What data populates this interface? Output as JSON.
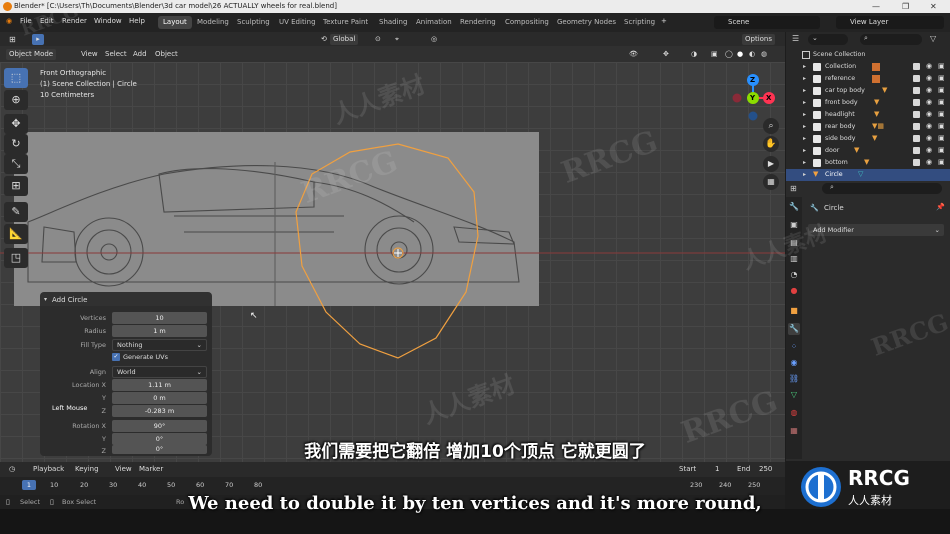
{
  "titlebar": {
    "title": "Blender* [C:\\Users\\Th\\Documents\\Blender\\3d car model\\26 ACTUALLY wheels for real.blend]",
    "minimize": "—",
    "maximize": "❐",
    "close": "✕"
  },
  "menu": {
    "items": [
      "Edit",
      "Render",
      "Window",
      "Help"
    ],
    "file_label": "File",
    "workspaces": [
      "Layout",
      "Modeling",
      "Sculpting",
      "UV Editing",
      "Texture Paint",
      "Shading",
      "Animation",
      "Rendering",
      "Compositing",
      "Geometry Nodes",
      "Scripting"
    ],
    "active_workspace": "Layout",
    "add_workspace": "+",
    "scene": "Scene",
    "view_layer": "View Layer"
  },
  "viewport_header": {
    "mode": "Object Mode",
    "menus": [
      "View",
      "Select",
      "Add",
      "Object"
    ],
    "transform_orientation": "Global",
    "options": "Options"
  },
  "viewport": {
    "view_name": "Front Orthographic",
    "collection_info": "(1) Scene Collection | Circle",
    "scale": "10 Centimeters",
    "gizmo": {
      "x": "X",
      "y": "Y",
      "z": "Z"
    },
    "cursor_hint": "Left Mouse"
  },
  "tools": [
    "select-box",
    "cursor",
    "move",
    "rotate",
    "scale",
    "transform",
    "annotate",
    "measure",
    "add-cube"
  ],
  "operator_panel": {
    "title": "Add Circle",
    "vertices_label": "Vertices",
    "vertices": "10",
    "radius_label": "Radius",
    "radius": "1 m",
    "fill_type_label": "Fill Type",
    "fill_type": "Nothing",
    "generate_uvs": "Generate UVs",
    "align_label": "Align",
    "align": "World",
    "location_x_label": "Location X",
    "location_x": "1.11 m",
    "y_label": "Y",
    "location_y": "0 m",
    "z_label": "Z",
    "location_z": "-0.283 m",
    "rotation_x_label": "Rotation X",
    "rotation_x": "90°",
    "rotation_y": "0°",
    "rotation_z": "0°"
  },
  "timeline": {
    "menus": [
      "Playback",
      "Keying",
      "View",
      "Marker"
    ],
    "current_frame": "1",
    "start_label": "Start",
    "start": "1",
    "end_label": "End",
    "end": "250",
    "ticks_left": [
      "1",
      "10",
      "20",
      "30",
      "40",
      "50",
      "60",
      "70",
      "80"
    ],
    "ticks_right": [
      "230",
      "240",
      "250"
    ]
  },
  "statusbar": {
    "select": "Select",
    "box_select": "Box Select",
    "rotate": "Ro"
  },
  "outliner": {
    "search_placeholder": "",
    "root": "Scene Collection",
    "items": [
      "Collection",
      "reference",
      "car top body",
      "front body",
      "headlight",
      "rear body",
      "side body",
      "door",
      "bottom",
      "Circle"
    ]
  },
  "properties": {
    "object_name": "Circle",
    "add_modifier": "Add Modifier"
  },
  "subtitles": {
    "cn": "我们需要把它翻倍 增加10个顶点 它就更圆了",
    "en": "We need to double it by ten vertices and it's more round,"
  },
  "watermark": {
    "brand": "RRCG",
    "cn": "人人素材",
    "logo_text": "RRCG",
    "logo_sub": "人人素材"
  },
  "colors": {
    "accent_blue": "#4772b3",
    "orange": "#e87d0d",
    "selection_orange": "#f0a040",
    "axis_red": "#ff3352",
    "axis_green": "#8bdc00",
    "axis_blue": "#2890ff"
  }
}
